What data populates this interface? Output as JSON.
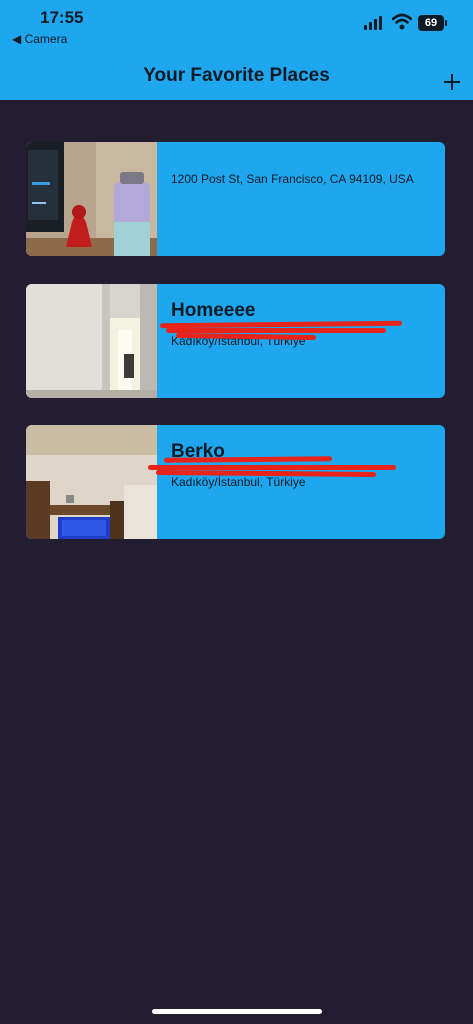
{
  "status_bar": {
    "time": "17:55",
    "back_label": "◀ Camera",
    "battery": "69"
  },
  "header": {
    "title": "Your Favorite Places",
    "add_icon": "plus-icon"
  },
  "places": [
    {
      "title": "",
      "address": "1200 Post St, San Francisco, CA 94109, USA",
      "image": "photo-desk-with-bottle"
    },
    {
      "title": "Homeeee",
      "address": "Kadıköy/İstanbul, Türkiye",
      "image": "photo-hallway"
    },
    {
      "title": "Berko",
      "address": "Kadıköy/İstanbul, Türkiye",
      "image": "photo-living-room-tv"
    }
  ],
  "colors": {
    "accent": "#1ea6ee",
    "background": "#221d31",
    "text": "#0d1b26",
    "redaction": "#e8231a"
  }
}
